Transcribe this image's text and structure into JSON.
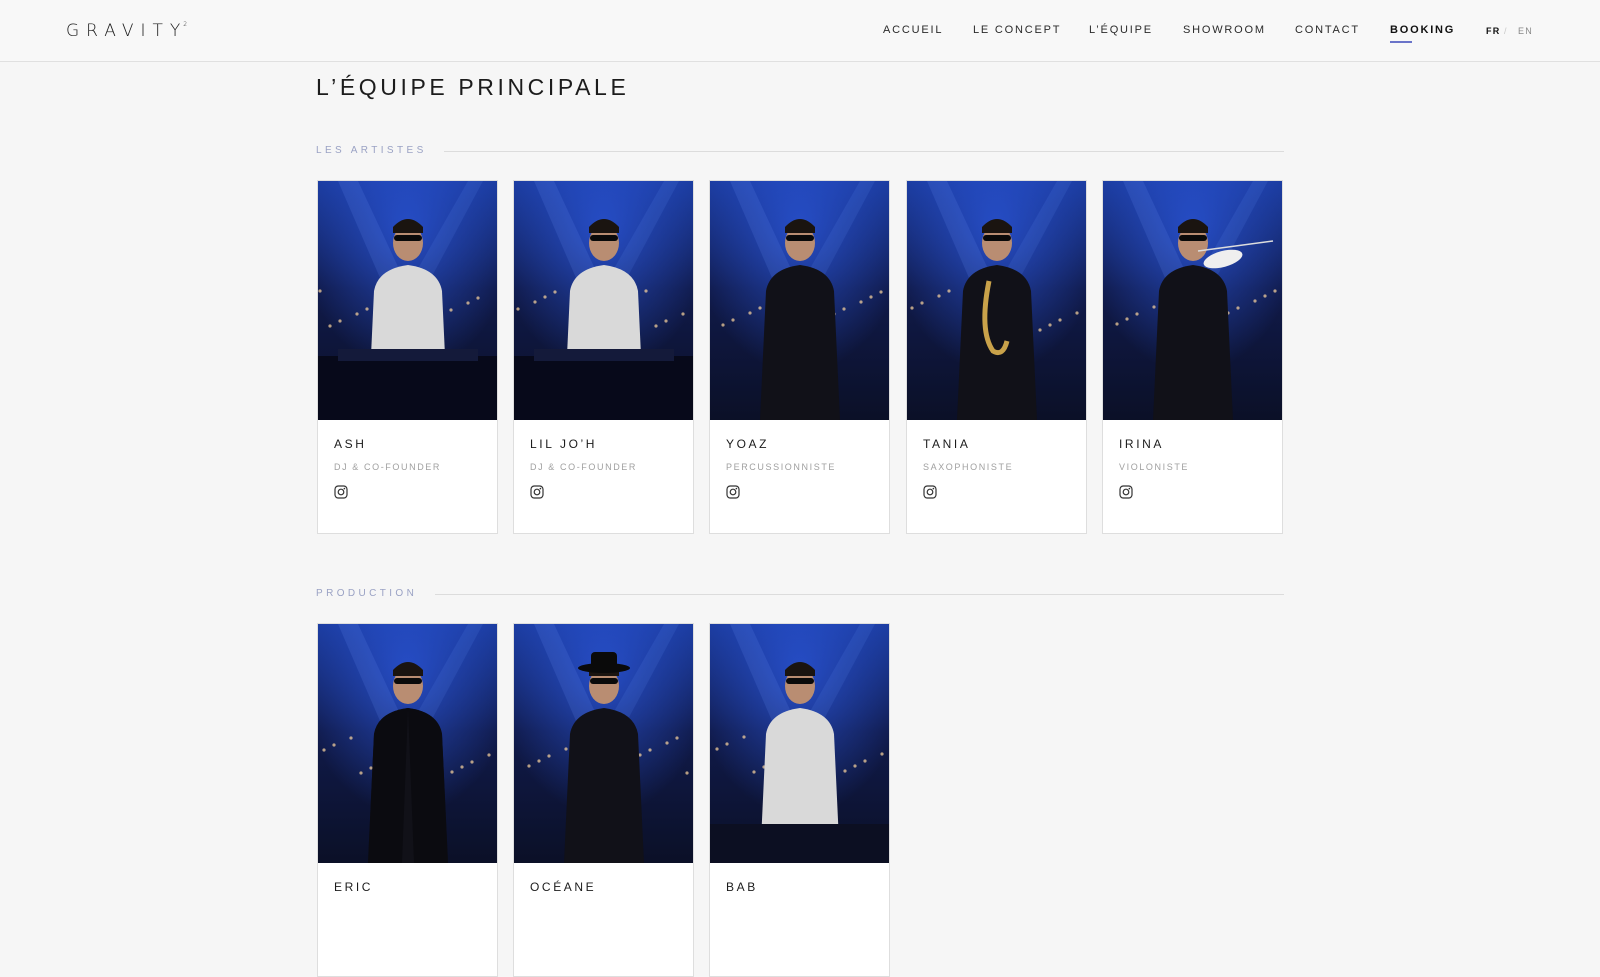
{
  "header": {
    "logo": "GRAVITY",
    "logo_sup": "2",
    "nav": [
      {
        "label": "ACCUEIL"
      },
      {
        "label": "LE CONCEPT"
      },
      {
        "label": "L’ÉQUIPE"
      },
      {
        "label": "SHOWROOM"
      },
      {
        "label": "CONTACT"
      },
      {
        "label": "BOOKING"
      }
    ],
    "lang": {
      "fr": "FR",
      "sep": "/",
      "en": "EN"
    }
  },
  "page": {
    "title": "L’ÉQUIPE PRINCIPALE"
  },
  "sections": [
    {
      "label": "LES ARTISTES",
      "members": [
        {
          "name": "ASH",
          "role": "DJ & CO-FOUNDER"
        },
        {
          "name": "LIL JO’H",
          "role": "DJ & CO-FOUNDER"
        },
        {
          "name": "YOAZ",
          "role": "PERCUSSIONNISTE"
        },
        {
          "name": "TANIA",
          "role": "SAXOPHONISTE"
        },
        {
          "name": "IRINA",
          "role": "VIOLONISTE"
        }
      ]
    },
    {
      "label": "PRODUCTION",
      "members": [
        {
          "name": "ERIC",
          "role": ""
        },
        {
          "name": "OCÉANE",
          "role": ""
        },
        {
          "name": "BAB",
          "role": ""
        }
      ]
    }
  ],
  "colors": {
    "accent": "#6a74c9",
    "section_label": "#9aa2c4",
    "background": "#f6f6f6",
    "photo_dark": "#0b1027",
    "photo_blue": "#2a55d8"
  },
  "icons": {
    "social": "instagram-icon"
  }
}
